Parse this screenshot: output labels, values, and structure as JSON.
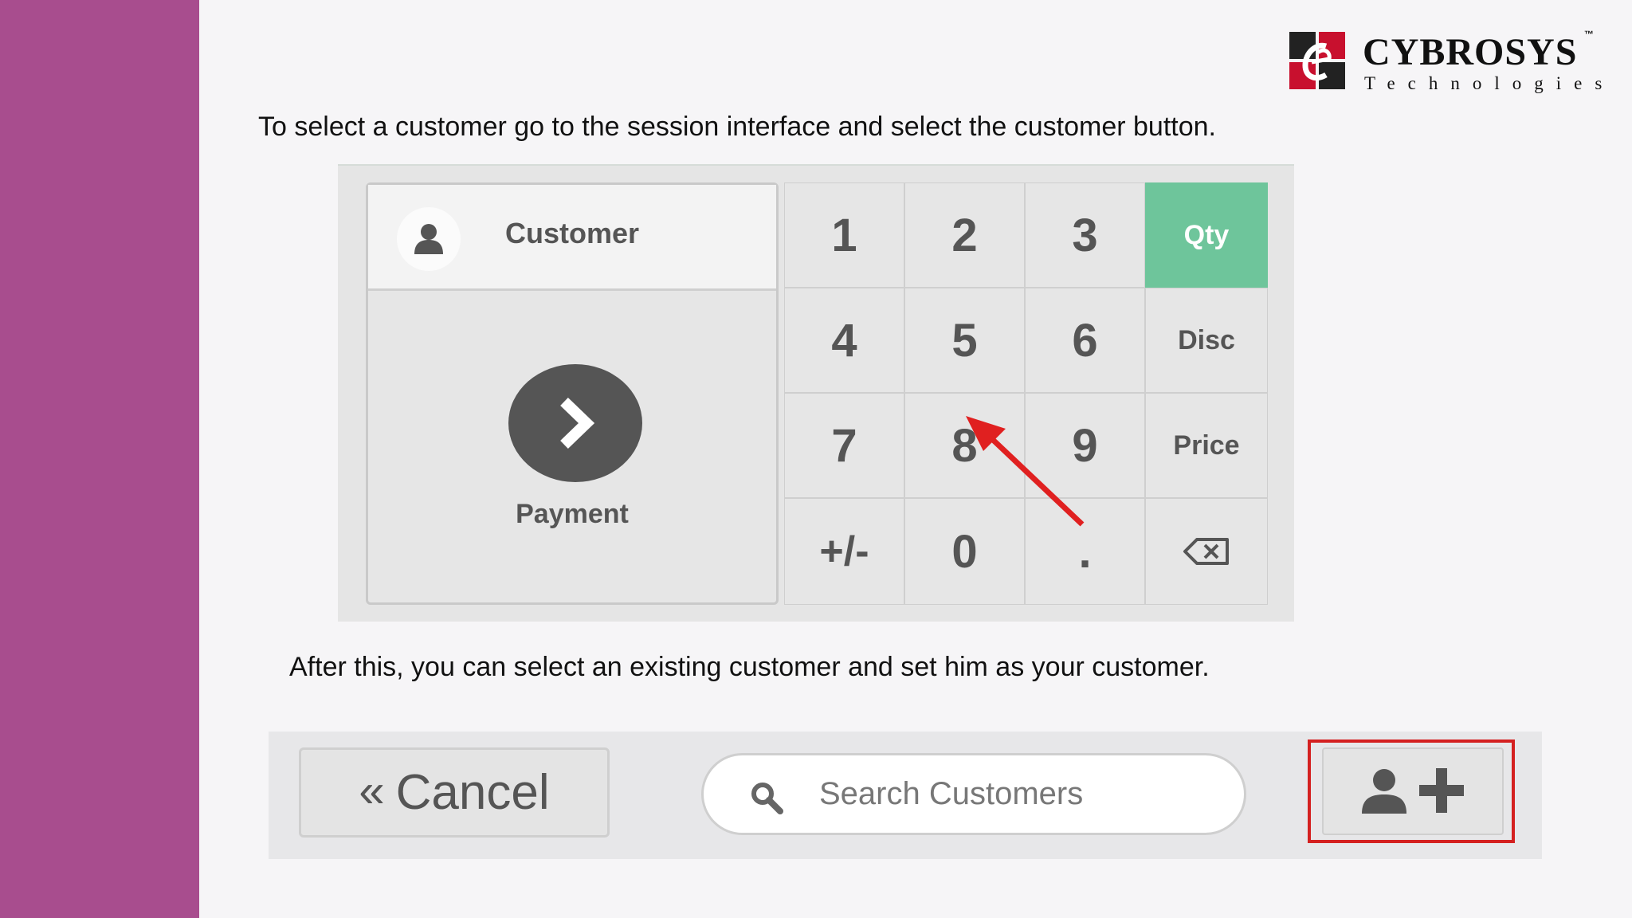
{
  "brand": {
    "name": "CYBROSYS",
    "trademark": "™",
    "tagline": "Technologies",
    "colors": {
      "sidebar": "#a84d8e",
      "mark_red": "#c8102e",
      "mark_dark": "#222222"
    }
  },
  "captions": {
    "select_customer": "To select a customer go to the session interface and select the customer button.",
    "after_this": "After this, you can select an existing customer and set him as your customer."
  },
  "pos_panel": {
    "customer_label": "Customer",
    "customer_icon": "user-icon",
    "payment_label": "Payment",
    "payment_icon": "chevron-right-icon",
    "keys": [
      [
        "1",
        "2",
        "3",
        "Qty"
      ],
      [
        "4",
        "5",
        "6",
        "Disc"
      ],
      [
        "7",
        "8",
        "9",
        "Price"
      ],
      [
        "+/-",
        "0",
        ".",
        "backspace-icon"
      ]
    ],
    "accent_color": "#6ec59b",
    "arrow_color": "#e02020"
  },
  "customer_bar": {
    "cancel_label": "Cancel",
    "cancel_icon": "double-chevron-left-icon",
    "search_placeholder": "Search Customers",
    "search_icon": "search-icon",
    "add_customer_icon": "add-user-icon",
    "highlight_color": "#d42020"
  }
}
